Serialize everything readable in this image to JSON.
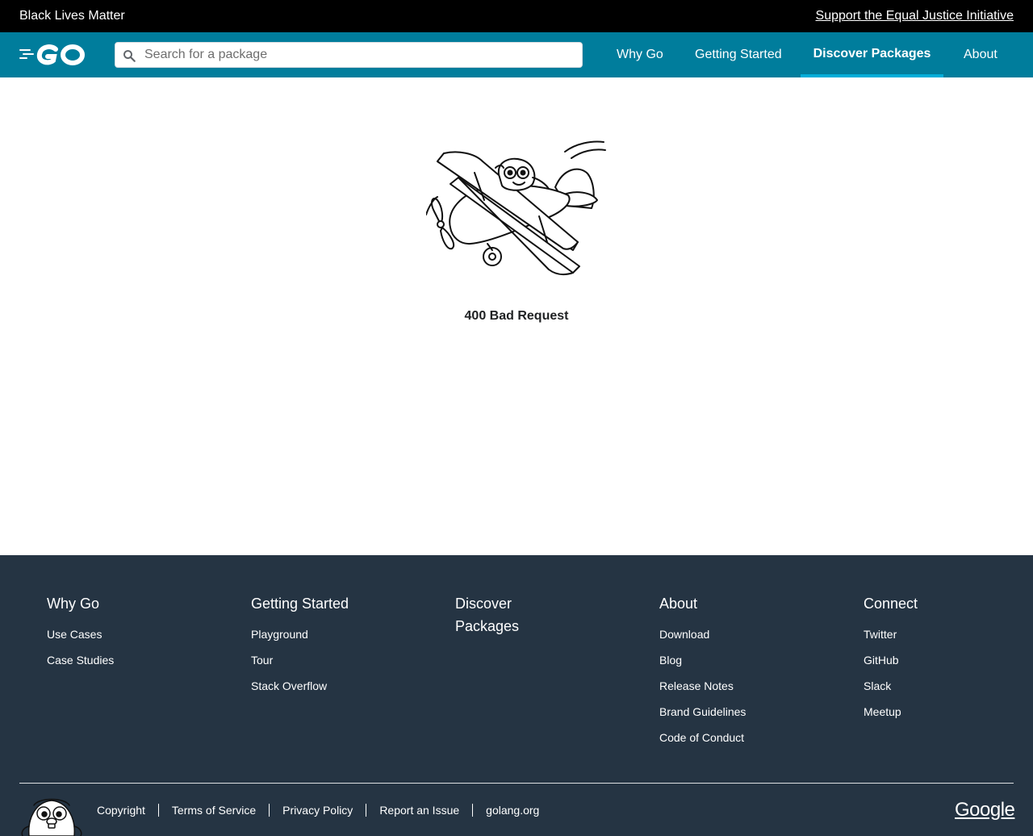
{
  "banner": {
    "text": "Black Lives Matter",
    "link": "Support the Equal Justice Initiative"
  },
  "header": {
    "logo_alt": "Go",
    "search_placeholder": "Search for a package",
    "nav": {
      "why_go": "Why Go",
      "getting_started": "Getting Started",
      "discover_packages": "Discover Packages",
      "about": "About"
    },
    "active_nav": "Discover Packages"
  },
  "main": {
    "illustration": "gopher-airplane-illustration",
    "error_message": "400 Bad Request"
  },
  "footer": {
    "columns": [
      {
        "title": "Why Go",
        "links": [
          "Use Cases",
          "Case Studies"
        ]
      },
      {
        "title": "Getting Started",
        "links": [
          "Playground",
          "Tour",
          "Stack Overflow"
        ]
      },
      {
        "title": "Discover Packages",
        "links": []
      },
      {
        "title": "About",
        "links": [
          "Download",
          "Blog",
          "Release Notes",
          "Brand Guidelines",
          "Code of Conduct"
        ]
      },
      {
        "title": "Connect",
        "links": [
          "Twitter",
          "GitHub",
          "Slack",
          "Meetup"
        ]
      }
    ],
    "bottom_links": [
      "Copyright",
      "Terms of Service",
      "Privacy Policy",
      "Report an Issue",
      "golang.org"
    ],
    "google": "Google"
  },
  "colors": {
    "banner_bg": "#000000",
    "header_bg": "#007d9c",
    "active_underline": "#00add8",
    "footer_bg": "#253443"
  },
  "icons": [
    "go-logo-icon",
    "search-icon",
    "gopher-airplane-icon",
    "gopher-footer-icon",
    "google-logo"
  ]
}
